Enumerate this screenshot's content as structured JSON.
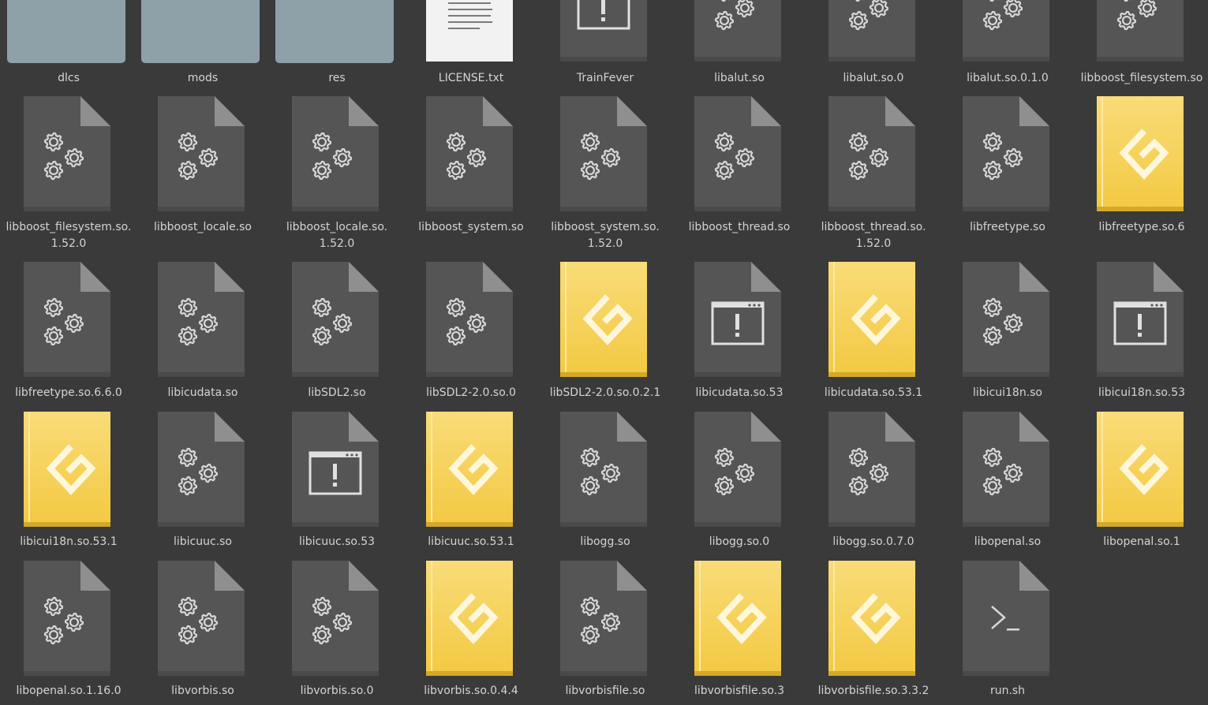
{
  "colors": {
    "background": "#3a3a3a",
    "doc_body": "#555555",
    "doc_fold": "#8f8f8f",
    "folder": "#8ea1a8",
    "link_yellow": "#f5cf52",
    "text_doc": "#f2f2f2",
    "label": "#d4d4d4"
  },
  "rows": [
    [
      {
        "name": "dlcs",
        "type": "folder",
        "icon": "folder-icon"
      },
      {
        "name": "mods",
        "type": "folder",
        "icon": "folder-icon"
      },
      {
        "name": "res",
        "type": "folder",
        "icon": "folder-icon"
      },
      {
        "name": "LICENSE.txt",
        "type": "text",
        "icon": "text-file-icon"
      },
      {
        "name": "TrainFever",
        "type": "exec",
        "icon": "executable-icon"
      },
      {
        "name": "libalut.so",
        "type": "lib",
        "icon": "gears-icon"
      },
      {
        "name": "libalut.so.0",
        "type": "lib",
        "icon": "gears-icon"
      },
      {
        "name": "libalut.so.0.1.0",
        "type": "lib",
        "icon": "gears-icon"
      },
      {
        "name": "libboost_filesystem.so",
        "type": "lib",
        "icon": "gears-icon"
      }
    ],
    [
      {
        "name": "libboost_filesystem.so.",
        "name2": "1.52.0",
        "type": "lib",
        "icon": "gears-icon"
      },
      {
        "name": "libboost_locale.so",
        "type": "lib",
        "icon": "gears-icon"
      },
      {
        "name": "libboost_locale.so.",
        "name2": "1.52.0",
        "type": "lib",
        "icon": "gears-icon"
      },
      {
        "name": "libboost_system.so",
        "type": "lib",
        "icon": "gears-icon"
      },
      {
        "name": "libboost_system.so.",
        "name2": "1.52.0",
        "type": "lib",
        "icon": "gears-icon"
      },
      {
        "name": "libboost_thread.so",
        "type": "lib",
        "icon": "gears-icon"
      },
      {
        "name": "libboost_thread.so.",
        "name2": "1.52.0",
        "type": "lib",
        "icon": "gears-icon"
      },
      {
        "name": "libfreetype.so",
        "type": "lib",
        "icon": "gears-icon"
      },
      {
        "name": "libfreetype.so.6",
        "type": "link",
        "icon": "link-icon"
      }
    ],
    [
      {
        "name": "libfreetype.so.6.6.0",
        "type": "lib",
        "icon": "gears-icon"
      },
      {
        "name": "libicudata.so",
        "type": "lib",
        "icon": "gears-icon"
      },
      {
        "name": "libSDL2.so",
        "type": "lib",
        "icon": "gears-icon"
      },
      {
        "name": "libSDL2-2.0.so.0",
        "type": "lib",
        "icon": "gears-icon"
      },
      {
        "name": "libSDL2-2.0.so.0.2.1",
        "type": "link",
        "icon": "link-icon"
      },
      {
        "name": "libicudata.so.53",
        "type": "exec",
        "icon": "executable-icon"
      },
      {
        "name": "libicudata.so.53.1",
        "type": "link",
        "icon": "link-icon"
      },
      {
        "name": "libicui18n.so",
        "type": "lib",
        "icon": "gears-icon"
      },
      {
        "name": "libicui18n.so.53",
        "type": "exec",
        "icon": "executable-icon"
      }
    ],
    [
      {
        "name": "libicui18n.so.53.1",
        "type": "link",
        "icon": "link-icon"
      },
      {
        "name": "libicuuc.so",
        "type": "lib",
        "icon": "gears-icon"
      },
      {
        "name": "libicuuc.so.53",
        "type": "exec",
        "icon": "executable-icon"
      },
      {
        "name": "libicuuc.so.53.1",
        "type": "link",
        "icon": "link-icon"
      },
      {
        "name": "libogg.so",
        "type": "lib",
        "icon": "gears-icon"
      },
      {
        "name": "libogg.so.0",
        "type": "lib",
        "icon": "gears-icon"
      },
      {
        "name": "libogg.so.0.7.0",
        "type": "lib",
        "icon": "gears-icon"
      },
      {
        "name": "libopenal.so",
        "type": "lib",
        "icon": "gears-icon"
      },
      {
        "name": "libopenal.so.1",
        "type": "link",
        "icon": "link-icon"
      }
    ],
    [
      {
        "name": "libopenal.so.1.16.0",
        "type": "lib",
        "icon": "gears-icon"
      },
      {
        "name": "libvorbis.so",
        "type": "lib",
        "icon": "gears-icon"
      },
      {
        "name": "libvorbis.so.0",
        "type": "lib",
        "icon": "gears-icon"
      },
      {
        "name": "libvorbis.so.0.4.4",
        "type": "link",
        "icon": "link-icon"
      },
      {
        "name": "libvorbisfile.so",
        "type": "lib",
        "icon": "gears-icon"
      },
      {
        "name": "libvorbisfile.so.3",
        "type": "link",
        "icon": "link-icon"
      },
      {
        "name": "libvorbisfile.so.3.3.2",
        "type": "link",
        "icon": "link-icon"
      },
      {
        "name": "run.sh",
        "type": "script",
        "icon": "terminal-icon"
      }
    ]
  ]
}
